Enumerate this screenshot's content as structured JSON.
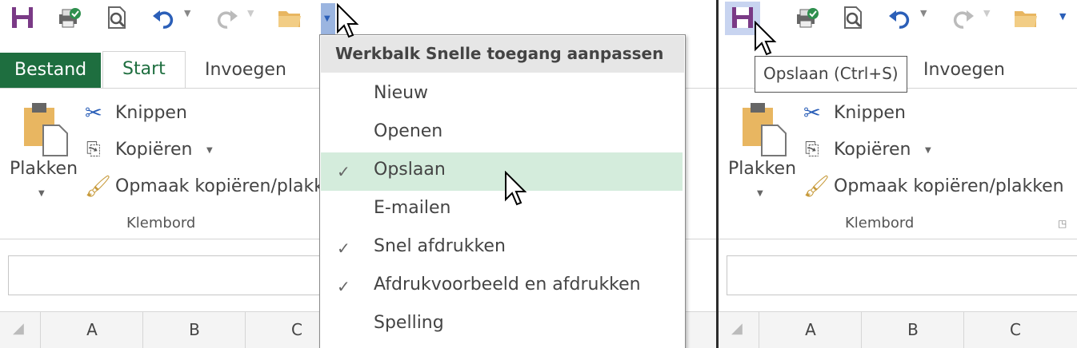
{
  "left": {
    "tabs": {
      "file": "Bestand",
      "start": "Start",
      "insert": "Invoegen"
    },
    "clipboard": {
      "paste": "Plakken",
      "cut": "Knippen",
      "copy": "Kopiëren",
      "format_painter": "Opmaak kopiëren/plakk",
      "group": "Klembord"
    },
    "columns": [
      "A",
      "B",
      "C"
    ]
  },
  "dropdown": {
    "title": "Werkbalk Snelle toegang aanpassen",
    "items": [
      {
        "label": "Nieuw",
        "checked": false
      },
      {
        "label": "Openen",
        "checked": false
      },
      {
        "label": "Opslaan",
        "checked": true,
        "highlighted": true
      },
      {
        "label": "E-mailen",
        "checked": false
      },
      {
        "label": "Snel afdrukken",
        "checked": true
      },
      {
        "label": "Afdrukvoorbeeld en afdrukken",
        "checked": true
      },
      {
        "label": "Spelling",
        "checked": false
      }
    ],
    "check_glyph": "✓"
  },
  "right": {
    "tooltip": "Opslaan (Ctrl+S)",
    "tabs": {
      "insert": "Invoegen"
    },
    "clipboard": {
      "paste": "Plakken",
      "cut": "Knippen",
      "copy": "Kopiëren",
      "format_painter": "Opmaak kopiëren/plakken",
      "group": "Klembord"
    },
    "columns": [
      "A",
      "B",
      "C"
    ]
  },
  "colors": {
    "file_tab": "#1e6e3f",
    "save_icon": "#7a3a86",
    "highlight": "#d4ecdc",
    "qat_dropdown": "#9bb5e0"
  }
}
